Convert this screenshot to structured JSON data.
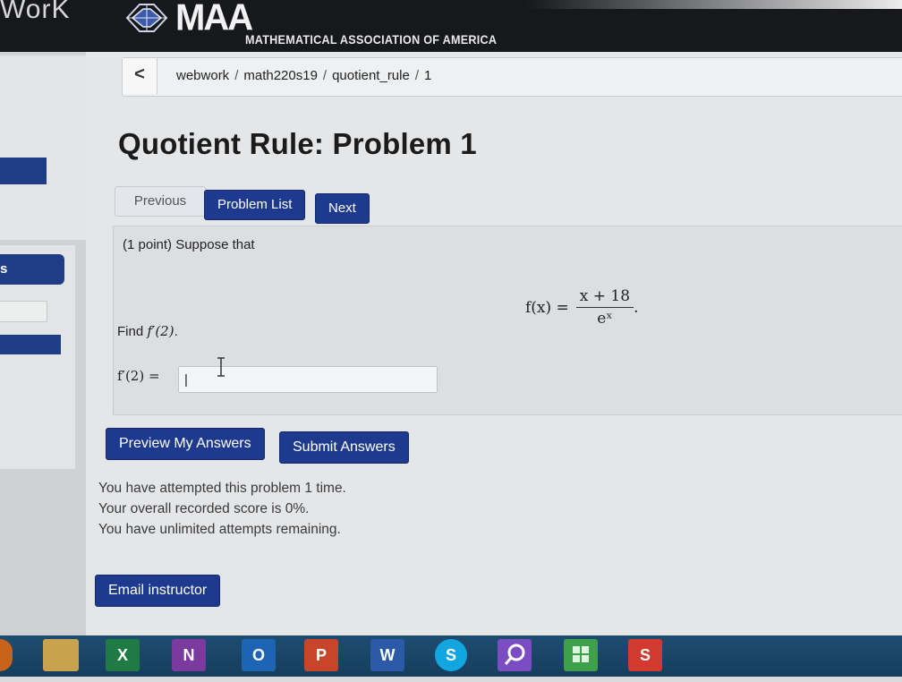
{
  "header": {
    "left_text": "WorK",
    "logo_text": "MAA",
    "logo_subtitle": "MATHEMATICAL ASSOCIATION OF AMERICA"
  },
  "breadcrumb": {
    "back_label": "<",
    "items": [
      "webwork",
      "math220s19",
      "quotient_rule",
      "1"
    ]
  },
  "sidebar": {
    "item_label": "s"
  },
  "page": {
    "title": "Quotient Rule: Problem 1"
  },
  "nav": {
    "previous": "Previous",
    "problem_list": "Problem List",
    "next": "Next"
  },
  "problem": {
    "intro": "(1 point) Suppose that",
    "equation_lhs": "f(x) =",
    "numerator": "x + 18",
    "denominator": "eˣ",
    "equation_end": ".",
    "find_prefix": "Find ",
    "find_expr": "f′(2)",
    "find_suffix": ".",
    "answer_label": "f′(2) =",
    "answer_value": "|"
  },
  "actions": {
    "preview": "Preview My Answers",
    "submit": "Submit Answers"
  },
  "status": {
    "line1": "You have attempted this problem 1 time.",
    "line2": "Your overall recorded score is 0%.",
    "line3": "You have unlimited attempts remaining."
  },
  "email": {
    "label": "Email instructor"
  },
  "taskbar": {
    "excel": "X",
    "onenote": "N",
    "outlook": "O",
    "powerpoint": "P",
    "word": "W",
    "skype": "S",
    "s_app": "S"
  }
}
